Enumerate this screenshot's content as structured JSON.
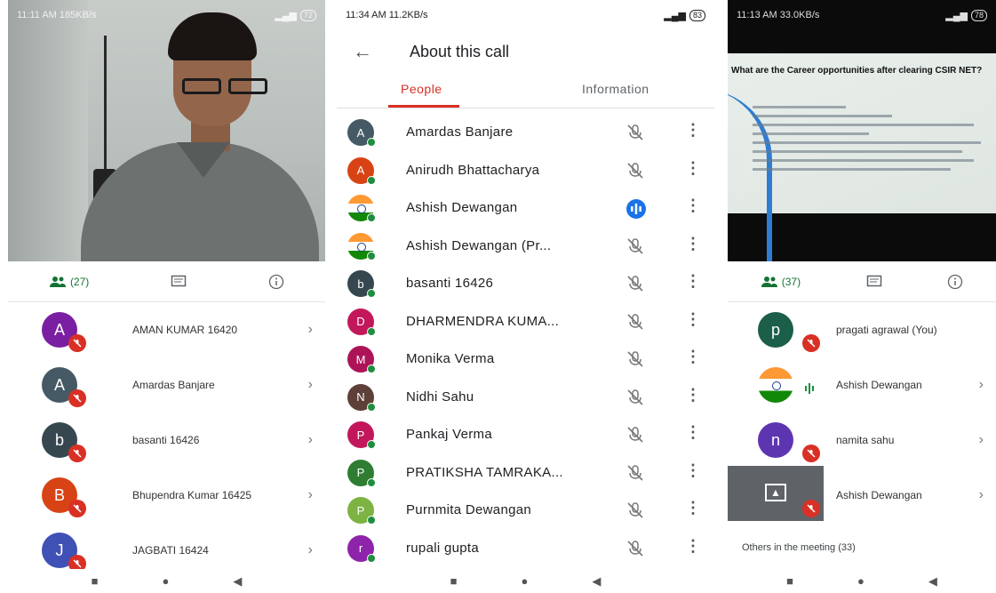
{
  "panel1": {
    "status": {
      "time": "11:11 AM",
      "speed": "185KB/s",
      "battery": "72"
    },
    "tabs": [
      {
        "label": "(27)",
        "icon": "people-icon",
        "active": true
      },
      {
        "label": "",
        "icon": "chat-icon",
        "active": false
      },
      {
        "label": "",
        "icon": "info-icon",
        "active": false
      }
    ],
    "participants": [
      {
        "initial": "A",
        "name": "AMAN KUMAR 16420",
        "color": "#7b1fa2"
      },
      {
        "initial": "A",
        "name": "Amardas Banjare",
        "color": "#455a64"
      },
      {
        "initial": "b",
        "name": "basanti 16426",
        "color": "#37474f"
      },
      {
        "initial": "B",
        "name": "Bhupendra Kumar 16425",
        "color": "#d84315"
      },
      {
        "initial": "J",
        "name": "JAGBATI 16424",
        "color": "#3f51b5"
      }
    ]
  },
  "panel2": {
    "status": {
      "time": "11:34 AM",
      "speed": "11.2KB/s",
      "battery": "83"
    },
    "title": "About this call",
    "tab_people": "People",
    "tab_information": "Information",
    "participants": [
      {
        "initial": "A",
        "name": "Amardas Banjare",
        "color": "#455a64",
        "flag": false,
        "speaking": false
      },
      {
        "initial": "A",
        "name": "Anirudh Bhattacharya",
        "color": "#d84315",
        "flag": false,
        "speaking": false
      },
      {
        "initial": "",
        "name": "Ashish Dewangan",
        "color": "#ff9933",
        "flag": true,
        "speaking": true
      },
      {
        "initial": "",
        "name": "Ashish Dewangan (Pr...",
        "color": "#ff9933",
        "flag": true,
        "speaking": false
      },
      {
        "initial": "b",
        "name": "basanti 16426",
        "color": "#37474f",
        "flag": false,
        "speaking": false
      },
      {
        "initial": "D",
        "name": "DHARMENDRA KUMA...",
        "color": "#c2185b",
        "flag": false,
        "speaking": false
      },
      {
        "initial": "M",
        "name": "Monika Verma",
        "color": "#ad1457",
        "flag": false,
        "speaking": false
      },
      {
        "initial": "N",
        "name": "Nidhi Sahu",
        "color": "#5d4037",
        "flag": false,
        "speaking": false
      },
      {
        "initial": "P",
        "name": "Pankaj Verma",
        "color": "#c2185b",
        "flag": false,
        "speaking": false
      },
      {
        "initial": "P",
        "name": "PRATIKSHA TAMRAKA...",
        "color": "#2e7d32",
        "flag": false,
        "speaking": false
      },
      {
        "initial": "P",
        "name": "Purnmita Dewangan",
        "color": "#7cb342",
        "flag": false,
        "speaking": false
      },
      {
        "initial": "r",
        "name": "rupali gupta",
        "color": "#8e24aa",
        "flag": false,
        "speaking": false
      }
    ]
  },
  "panel3": {
    "status": {
      "time": "11:13 AM",
      "speed": "33.0KB/s",
      "battery": "78"
    },
    "slide_title": "What are the Career opportunities after clearing CSIR NET?",
    "tabs": [
      {
        "label": "(37)",
        "icon": "people-icon",
        "active": true
      },
      {
        "label": "",
        "icon": "chat-icon",
        "active": false
      },
      {
        "label": "",
        "icon": "info-icon",
        "active": false
      }
    ],
    "participants": [
      {
        "initial": "p",
        "name": "pragati agrawal (You)",
        "color": "#1b5e4a",
        "type": "muted",
        "chevron": false
      },
      {
        "initial": "",
        "name": "Ashish Dewangan",
        "color": "#ff9933",
        "type": "speaking",
        "chevron": true
      },
      {
        "initial": "n",
        "name": "namita sahu",
        "color": "#5e35b1",
        "type": "muted",
        "chevron": true
      },
      {
        "initial": "",
        "name": "Ashish Dewangan",
        "color": "#5f6368",
        "type": "sharing",
        "chevron": true
      }
    ],
    "others_label": "Others in the meeting (33)"
  },
  "colors": {
    "accent_green": "#137333",
    "mute_red": "#d93025",
    "tab_red": "#d93025",
    "speaking_blue": "#1a73e8"
  }
}
